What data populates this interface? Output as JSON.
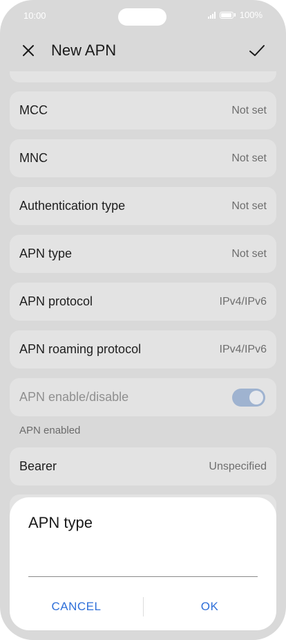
{
  "status_bar": {
    "time": "10:00",
    "battery": "100%"
  },
  "appbar": {
    "title": "New APN"
  },
  "rows": [
    {
      "label": "MCC",
      "value": "Not set"
    },
    {
      "label": "MNC",
      "value": "Not set"
    },
    {
      "label": "Authentication type",
      "value": "Not set"
    },
    {
      "label": "APN type",
      "value": "Not set"
    },
    {
      "label": "APN protocol",
      "value": "IPv4/IPv6"
    },
    {
      "label": "APN roaming protocol",
      "value": "IPv4/IPv6"
    }
  ],
  "apn_toggle": {
    "label": "APN enable/disable",
    "caption": "APN enabled",
    "on": true
  },
  "bearer": {
    "label": "Bearer",
    "value": "Unspecified"
  },
  "dialog": {
    "title": "APN type",
    "input_value": "",
    "cancel_label": "CANCEL",
    "ok_label": "OK"
  },
  "colors": {
    "accent": "#2e6fd9",
    "scrim_background": "#d9d9d9",
    "card": "#e3e3e3"
  }
}
